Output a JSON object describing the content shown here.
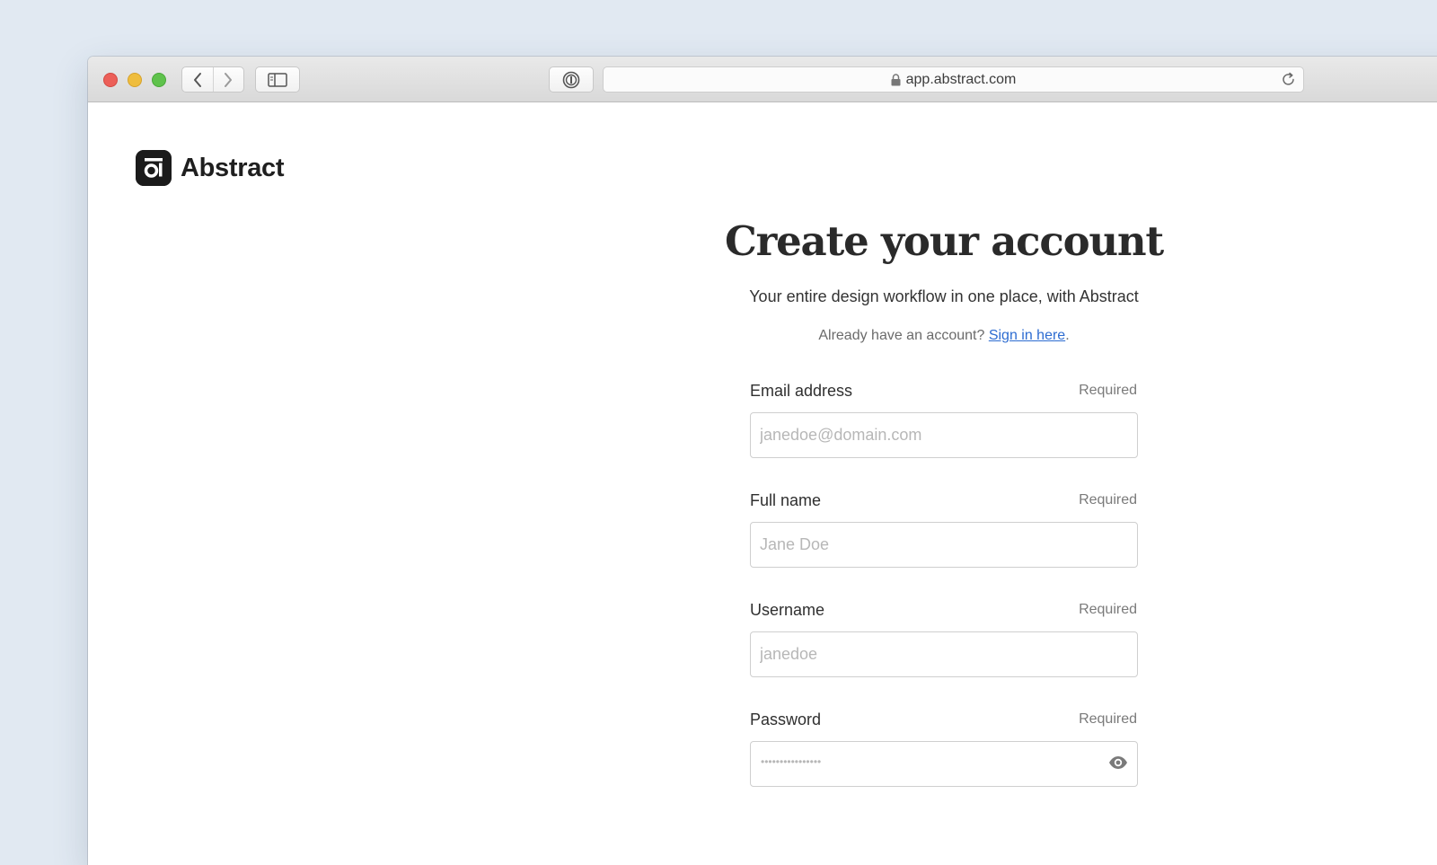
{
  "browser": {
    "url": "app.abstract.com",
    "icons": {
      "back": "chevron-left-icon",
      "forward": "chevron-right-icon",
      "sidebar": "sidebar-icon",
      "password_manager": "1password-icon",
      "lock": "lock-icon",
      "reload": "reload-icon"
    }
  },
  "brand": {
    "name": "Abstract",
    "color": "#1b1b1b"
  },
  "page": {
    "title": "Create your account",
    "subtitle": "Your entire design workflow in one place, with Abstract",
    "signin_prompt": "Already have an account?",
    "signin_link": "Sign in here",
    "signin_suffix": ".",
    "link_color": "#2d6cd1"
  },
  "form": {
    "email": {
      "label": "Email address",
      "required": "Required",
      "placeholder": "janedoe@domain.com",
      "value": ""
    },
    "full_name": {
      "label": "Full name",
      "required": "Required",
      "placeholder": "Jane Doe",
      "value": ""
    },
    "username": {
      "label": "Username",
      "required": "Required",
      "placeholder": "janedoe",
      "value": ""
    },
    "password": {
      "label": "Password",
      "required": "Required",
      "masked": "••••••••••••••••",
      "toggle_icon": "eye-icon"
    }
  }
}
